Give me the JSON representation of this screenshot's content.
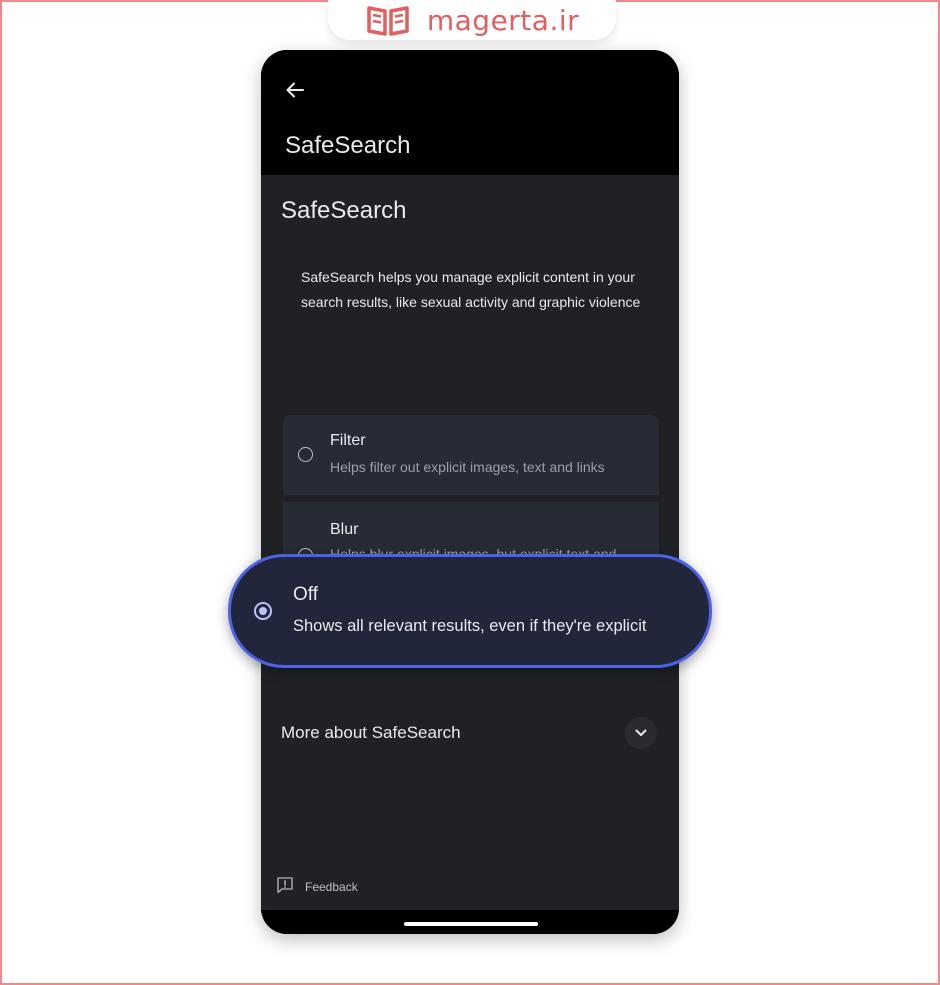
{
  "watermark": {
    "brand_text": "magerta.ir",
    "logo_icon": "open-book-logo-icon",
    "accent_color": "#e25f5f"
  },
  "app_bar": {
    "back_icon": "arrow-left-icon",
    "title": "SafeSearch"
  },
  "section": {
    "title": "SafeSearch",
    "description": "SafeSearch helps you manage explicit content in your search results, like sexual activity and graphic violence"
  },
  "options": [
    {
      "title": "Filter",
      "subtitle": "Helps filter out explicit images, text and links",
      "selected": false
    },
    {
      "title": "Blur",
      "subtitle": "Helps blur explicit images, but explicit text and links may show",
      "selected": false
    },
    {
      "title": "Off",
      "subtitle": "Shows all relevant results, even if they're explicit",
      "selected": true
    }
  ],
  "more_about": {
    "label": "More about SafeSearch",
    "icon": "chevron-down-icon"
  },
  "feedback": {
    "label": "Feedback",
    "icon": "feedback-icon"
  },
  "colors": {
    "background": "#202124",
    "option_background": "#262b36",
    "highlight_border": "#4e62e8",
    "selected_radio": "#b9c3ff"
  }
}
